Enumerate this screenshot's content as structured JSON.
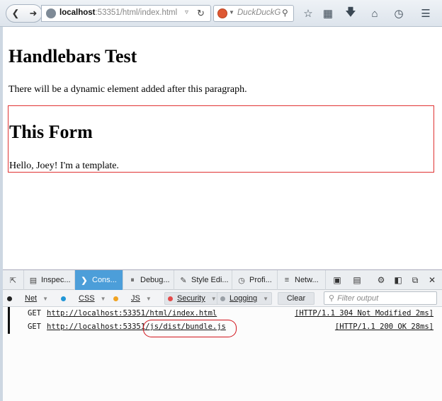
{
  "browser": {
    "url_host": "localhost",
    "url_rest": ":53351/html/index.html",
    "search_placeholder": "DuckDuckG"
  },
  "page": {
    "title": "Handlebars Test",
    "intro": "There will be a dynamic element added after this paragraph.",
    "form_title": "This Form",
    "greeting": "Hello, Joey! I'm a template."
  },
  "devtools": {
    "tabs": [
      {
        "label": "Inspec...",
        "icon": "inspector-icon"
      },
      {
        "label": "Cons...",
        "icon": "console-icon"
      },
      {
        "label": "Debug...",
        "icon": "debugger-icon"
      },
      {
        "label": "Style Edi...",
        "icon": "style-editor-icon"
      },
      {
        "label": "Profi...",
        "icon": "profiler-icon"
      },
      {
        "label": "Netw...",
        "icon": "network-icon"
      }
    ],
    "filters": {
      "net": "Net",
      "css": "CSS",
      "js": "JS",
      "security": "Security",
      "logging": "Logging",
      "clear": "Clear",
      "filter_placeholder": "Filter output"
    },
    "colors": {
      "net": "#222222",
      "css": "#2196d6",
      "js": "#f0a322",
      "security": "#e34b4b",
      "logging": "#9aa0a6",
      "active_tab": "#4c9ed9"
    },
    "log": [
      {
        "method": "GET",
        "url": "http://localhost:53351/html/index.html",
        "status": "[HTTP/1.1 304 Not Modified 2ms]"
      },
      {
        "method": "GET",
        "url": "http://localhost:53351/js/dist/bundle.js",
        "status": "[HTTP/1.1 200 OK 28ms]"
      }
    ]
  }
}
